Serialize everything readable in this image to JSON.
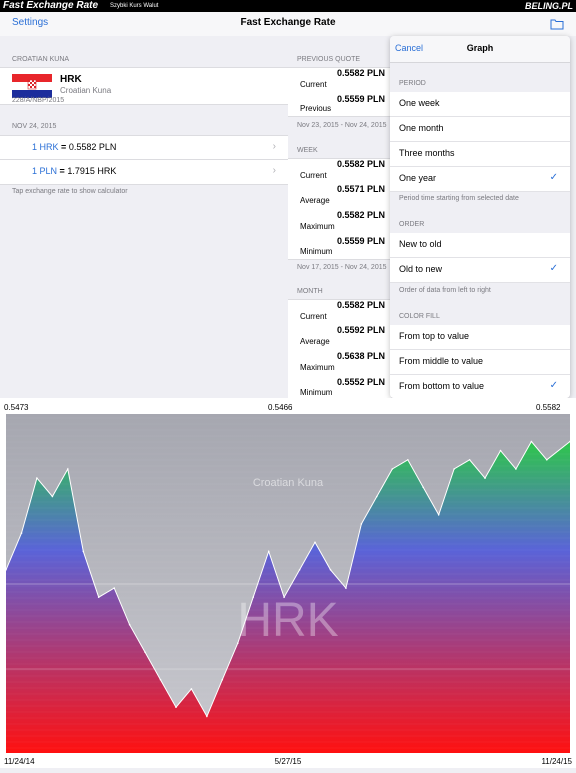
{
  "banner": {
    "app_name": "Fast Exchange Rate",
    "subtitle": "Szybki Kurs Walut",
    "brand": "BELING.PL"
  },
  "navbar": {
    "left": "Settings",
    "title": "Fast Exchange Rate",
    "right_icon": "folder-icon"
  },
  "currency": {
    "section": "CROATIAN KUNA",
    "code": "HRK",
    "name": "Croatian Kuna",
    "table_no": "228/A/NBP/2015",
    "date": "NOV 24, 2015",
    "rate1_left": "1 HRK",
    "rate1_eq": "=",
    "rate1_right": "0.5582 PLN",
    "rate2_left": "1 PLN",
    "rate2_eq": "=",
    "rate2_right": "1.7915 HRK",
    "hint": "Tap exchange rate to show calculator",
    "chevron": "›"
  },
  "quotes": {
    "prev_section": "PREVIOUS QUOTE",
    "current_label": "Current",
    "current_value": "0.5582 PLN",
    "previous_label": "Previous",
    "previous_value": "0.5559 PLN",
    "prev_range": "Nov 23, 2015 - Nov 24, 2015",
    "week_section": "WEEK",
    "week": [
      {
        "label": "Current",
        "value": "0.5582 PLN"
      },
      {
        "label": "Average",
        "value": "0.5571 PLN"
      },
      {
        "label": "Maximum",
        "value": "0.5582 PLN"
      },
      {
        "label": "Minimum",
        "value": "0.5559 PLN"
      }
    ],
    "week_range": "Nov 17, 2015 - Nov 24, 2015",
    "month_section": "MONTH",
    "month": [
      {
        "label": "Current",
        "value": "0.5582 PLN"
      },
      {
        "label": "Average",
        "value": "0.5592 PLN"
      },
      {
        "label": "Maximum",
        "value": "0.5638 PLN"
      },
      {
        "label": "Minimum",
        "value": "0.5552 PLN"
      }
    ]
  },
  "popover": {
    "cancel": "Cancel",
    "title": "Graph",
    "period_section": "PERIOD",
    "period_options": [
      "One week",
      "One month",
      "Three months",
      "One year"
    ],
    "period_selected": 3,
    "period_note": "Period time starting from selected date",
    "order_section": "ORDER",
    "order_options": [
      "New to old",
      "Old to new"
    ],
    "order_selected": 1,
    "order_note": "Order of data from left to right",
    "color_section": "COLOR FILL",
    "color_options": [
      "From top to value",
      "From middle to value",
      "From bottom to value"
    ],
    "color_selected": 2,
    "check": "✓"
  },
  "chart_data": {
    "type": "area",
    "title": "Croatian Kuna",
    "watermark": "HRK",
    "top_labels": {
      "left": "0.5473",
      "middle": "0.5466",
      "right": "0.5582"
    },
    "x_ticks": [
      "11/24/14",
      "5/27/15",
      "11/24/15"
    ],
    "x": [
      0,
      10,
      20,
      30,
      40,
      50,
      60,
      70,
      80,
      90,
      100,
      110,
      120,
      130,
      140,
      150,
      160,
      170,
      180,
      190,
      200,
      210,
      220,
      230,
      240,
      250,
      260,
      270,
      280,
      290,
      300,
      310,
      320,
      330,
      340,
      350,
      365
    ],
    "values": [
      0.5468,
      0.5472,
      0.5478,
      0.5476,
      0.5479,
      0.547,
      0.5465,
      0.5466,
      0.5462,
      0.5459,
      0.5456,
      0.5453,
      0.5455,
      0.5452,
      0.5456,
      0.546,
      0.5465,
      0.547,
      0.5465,
      0.5468,
      0.5471,
      0.5468,
      0.5466,
      0.5473,
      0.5476,
      0.5479,
      0.548,
      0.5477,
      0.5474,
      0.5479,
      0.548,
      0.5478,
      0.5481,
      0.5479,
      0.5482,
      0.548,
      0.5482
    ],
    "ylim": [
      0.5448,
      0.5485
    ],
    "colors": {
      "top": "#2ec64b",
      "mid": "#5a63d8",
      "bottom": "#ff1010",
      "background": "#8e909c"
    }
  }
}
